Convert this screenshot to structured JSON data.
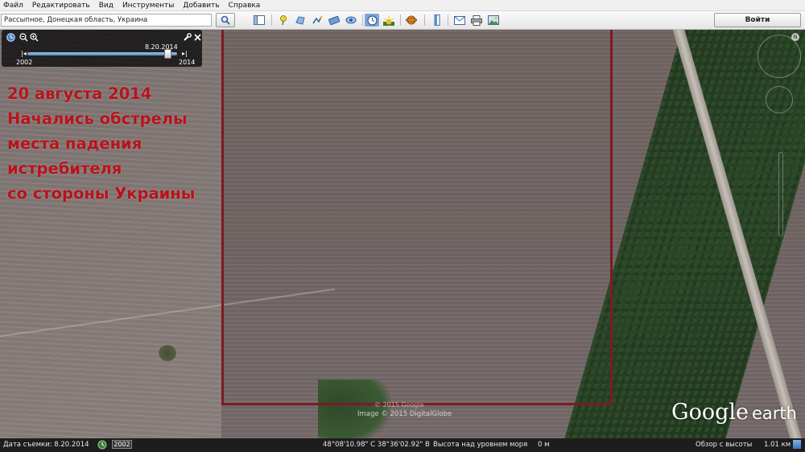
{
  "menubar": {
    "items": [
      "Файл",
      "Редактировать",
      "Вид",
      "Инструменты",
      "Добавить",
      "Справка"
    ]
  },
  "search": {
    "value": "Рассыпное, Донецкая область, Украина"
  },
  "toolbar": {
    "login_label": "Войти"
  },
  "timeslider": {
    "date": "8.20.2014",
    "start_year": "2002",
    "end_year": "2014",
    "position": 0.96
  },
  "annotation": {
    "lines": [
      "20 августа 2014",
      "Начались обстрелы",
      "места падения",
      "истребителя",
      "со стороны Украины"
    ],
    "color": "#b8131c"
  },
  "highlight": {
    "color": "#7d1a22"
  },
  "credits": {
    "copyright": "© 2015 Google",
    "imagery": "Image © 2015 DigitalGlobe"
  },
  "logo": {
    "google": "Google",
    "earth": "earth"
  },
  "statusbar": {
    "capture_date": "Дата съемки: 8.20.2014",
    "year": "2002",
    "coordinates": "48°08'10.98\" С  38°36'02.92\" В",
    "elevation_label": "Высота над уровнем моря",
    "elevation_value": "0 м",
    "eye_label": "Обзор с высоты",
    "eye_value": "1.01 км"
  }
}
